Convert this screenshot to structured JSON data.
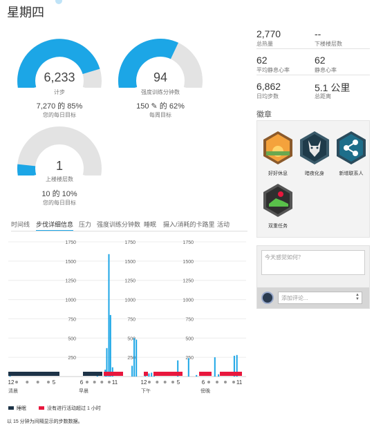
{
  "header": {
    "title": "星期四"
  },
  "gauges": {
    "steps": {
      "value": "6,233",
      "label": "计步",
      "goal": "7,270 的 85%",
      "goal_label": "您的每日目标",
      "fraction": 0.85
    },
    "intensity": {
      "value": "94",
      "label": "强度训练分钟数",
      "goal": "150 ✎ 的 62%",
      "goal_label": "每周目标",
      "fraction": 0.62
    },
    "floors": {
      "value": "1",
      "label": "上楼楼层数",
      "goal": "10 的 10%",
      "goal_label": "您的每日目标",
      "fraction": 0.1
    }
  },
  "stats": [
    {
      "value": "2,770",
      "label": "总热量"
    },
    {
      "value": "--",
      "label": "下楼楼层数"
    },
    {
      "value": "62",
      "label": "平均静息心率"
    },
    {
      "value": "62",
      "label": "静息心率"
    },
    {
      "value": "6,862",
      "label": "日均步数"
    },
    {
      "value": "5.1 公里",
      "label": "总距离"
    }
  ],
  "badges": {
    "title": "徽章",
    "items": [
      {
        "label": "好好休息",
        "icon": "sunrise-badge-icon"
      },
      {
        "label": "暗夜化身",
        "icon": "wolf-badge-icon"
      },
      {
        "label": "新增联系人",
        "icon": "share-badge-icon"
      },
      {
        "label": "双重任务",
        "icon": "shoe-badge-icon"
      }
    ]
  },
  "comment": {
    "placeholder": "今天感觉如何？",
    "add_placeholder": "添加评论..."
  },
  "tabs": [
    "时间线",
    "步伐详细信息",
    "压力",
    "强度训练分钟数",
    "睡眠",
    "摄入/消耗的卡路里",
    "活动"
  ],
  "legend": {
    "sleep": "睡眠",
    "inactive": "没有进行活动超过 1 小时",
    "sleep_color": "#1d3347",
    "inactive_color": "#e8173d",
    "bar_color": "#1ca6e6"
  },
  "footnote": "以 15 分钟为间隔显示的步数数据。",
  "chart_data": {
    "type": "bar",
    "ylim": [
      0,
      1750
    ],
    "yticks": [
      250,
      500,
      750,
      1000,
      1250,
      1500,
      1750
    ],
    "panels": [
      {
        "name": "清晨",
        "start_label": "12",
        "end_label": "5",
        "bars": [
          {
            "x": 0.02,
            "y": 50
          }
        ]
      },
      {
        "name": "早晨",
        "start_label": "6",
        "end_label": "11",
        "bars": [
          {
            "x": 0.55,
            "y": 10
          },
          {
            "x": 0.7,
            "y": 90
          },
          {
            "x": 0.73,
            "y": 370
          },
          {
            "x": 0.77,
            "y": 1590
          },
          {
            "x": 0.8,
            "y": 800
          },
          {
            "x": 0.84,
            "y": 120
          }
        ]
      },
      {
        "name": "下午",
        "start_label": "12",
        "end_label": "5",
        "bars": [
          {
            "x": 0.08,
            "y": 140
          },
          {
            "x": 0.12,
            "y": 500
          },
          {
            "x": 0.16,
            "y": 480
          },
          {
            "x": 0.33,
            "y": 30
          },
          {
            "x": 0.4,
            "y": 40
          },
          {
            "x": 0.45,
            "y": 50
          },
          {
            "x": 0.5,
            "y": 60
          },
          {
            "x": 0.95,
            "y": 210
          }
        ]
      },
      {
        "name": "傍晚",
        "start_label": "6",
        "end_label": "11",
        "bars": [
          {
            "x": 0.05,
            "y": 240
          },
          {
            "x": 0.2,
            "y": 20
          },
          {
            "x": 0.55,
            "y": 250
          },
          {
            "x": 0.62,
            "y": 30
          },
          {
            "x": 0.92,
            "y": 270
          },
          {
            "x": 0.97,
            "y": 280
          }
        ]
      }
    ]
  }
}
